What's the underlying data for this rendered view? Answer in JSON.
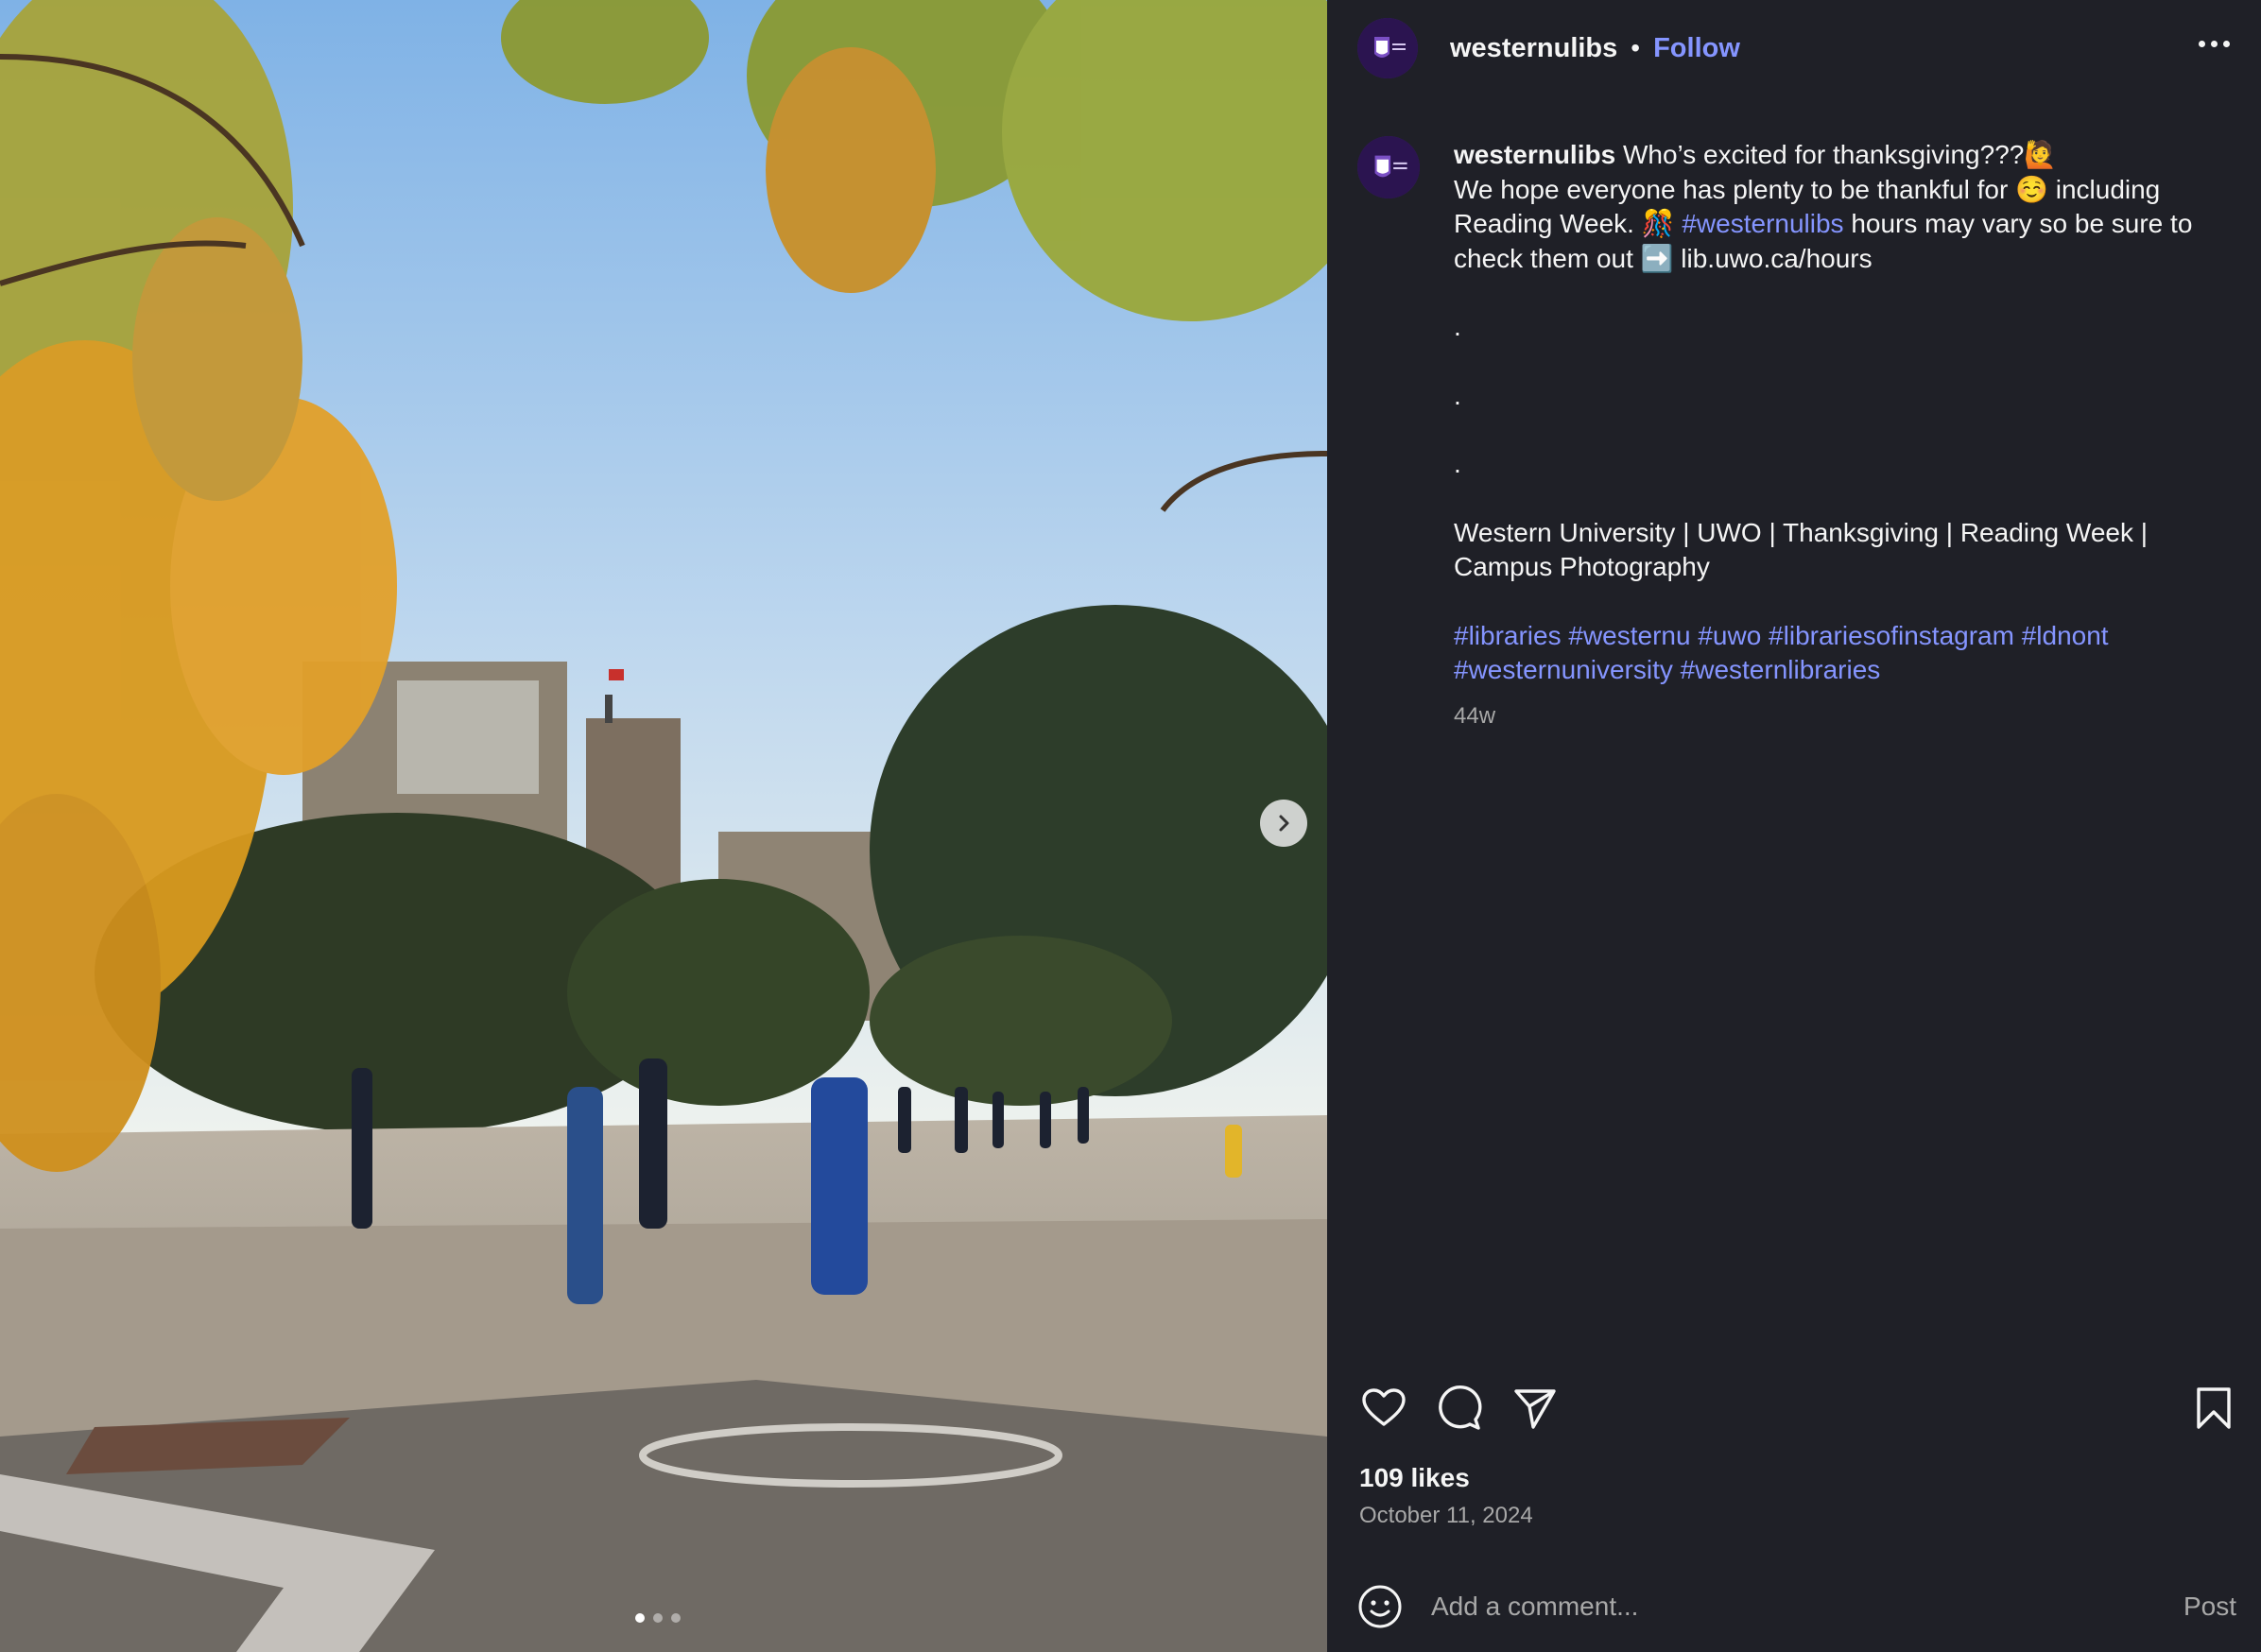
{
  "post": {
    "username": "westernulibs",
    "separator": "•",
    "follow_label": "Follow",
    "more_icon": "more-horizontal-icon"
  },
  "caption": {
    "username": "westernulibs",
    "line1": " Who’s excited for thanksgiving???🙋",
    "line2a": "We hope everyone has plenty to be thankful for ☺️ including Reading Week. 🎊 ",
    "hashtag_inline": "#westernulibs",
    "line2b": " hours may vary so be sure to check them out ➡️ lib.uwo.ca/hours",
    "dots": [
      ".",
      ".",
      "."
    ],
    "keywords": "Western University | UWO | Thanksgiving | Reading Week | Campus Photography",
    "hashtags": "#libraries #westernu #uwo #librariesofinstagram #ldnont #westernuniversity #westernlibraries",
    "time_ago": "44w"
  },
  "engagement": {
    "likes": "109 likes",
    "date": "October 11, 2024"
  },
  "comment": {
    "placeholder": "Add a comment...",
    "post_label": "Post"
  },
  "carousel": {
    "slide_count": 3,
    "active_index": 0
  },
  "colors": {
    "background": "#1f2027",
    "link": "#8595ff",
    "muted": "#a8a8a8",
    "text": "#f5f5f5"
  }
}
